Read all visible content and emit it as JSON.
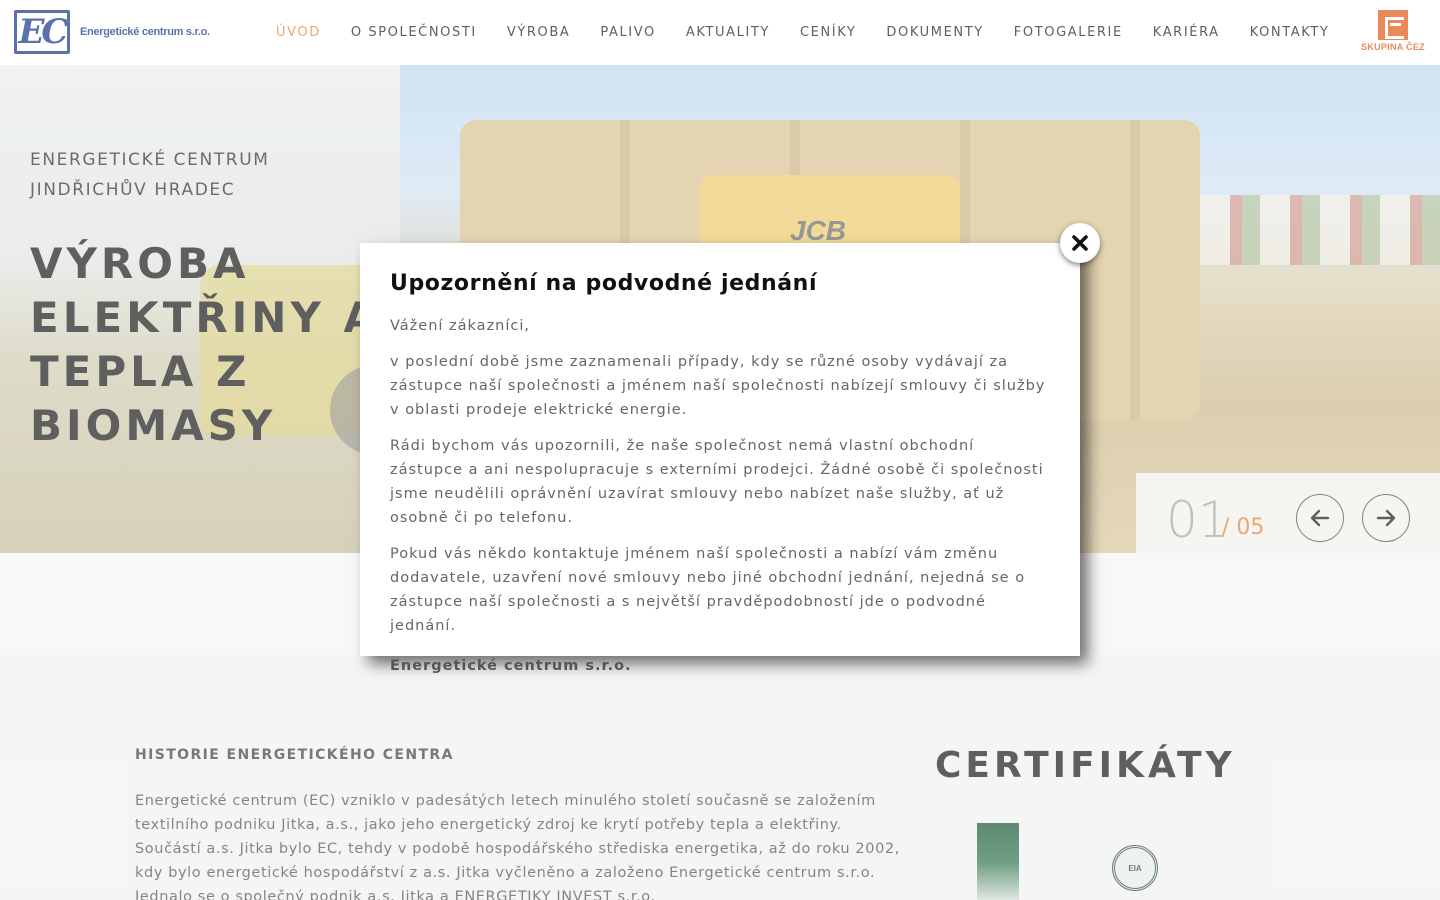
{
  "header": {
    "logo_mark": "EC",
    "logo_text": "Energetické centrum s.r.o.",
    "nav": [
      {
        "label": "ÚVOD",
        "active": true
      },
      {
        "label": "O SPOLEČNOSTI"
      },
      {
        "label": "VÝROBA"
      },
      {
        "label": "PALIVO"
      },
      {
        "label": "AKTUALITY"
      },
      {
        "label": "CENÍKY"
      },
      {
        "label": "DOKUMENTY"
      },
      {
        "label": "FOTOGALERIE"
      },
      {
        "label": "KARIÉRA"
      },
      {
        "label": "KONTAKTY"
      }
    ],
    "partner_label": "SKUPINA ČEZ",
    "accent_color": "#e8843a",
    "brand_color": "#1d3b8c",
    "partner_color": "#e35a1b"
  },
  "hero": {
    "subtitle_line1": "ENERGETICKÉ CENTRUM",
    "subtitle_line2": "JINDŘICHŮV HRADEC",
    "title": "VÝROBA ELEKTŘINY A TEPLA Z BIOMASY",
    "photo_label": "JCB",
    "slider": {
      "current": "01",
      "total": "/ 05",
      "prev_icon": "arrow-left-icon",
      "next_icon": "arrow-right-icon"
    }
  },
  "content": {
    "history_label": "HISTORIE ENERGETICKÉHO CENTRA",
    "history_text": "Energetické centrum (EC) vzniklo v padesátých letech minulého století současně se založením textilního podniku Jitka, a.s., jako jeho energetický zdroj ke krytí potřeby tepla a elektřiny. Součástí a.s. Jitka bylo EC, tehdy v podobě hospodářského střediska energetika, až do roku 2002, kdy bylo energetické hospodářství z a.s. Jitka vyčleněno a založeno Energetické centrum s.r.o. Jednalo se o společný podnik a.s. Jitka a ENERGETIKY INVEST s.r.o.",
    "cert_title": "CERTIFIKÁTY",
    "cert_badge": "EIA"
  },
  "modal": {
    "title": "Upozornění na podvodné jednání",
    "greeting": "Vážení zákazníci,",
    "p1": "v poslední době jsme zaznamenali případy, kdy se různé osoby vydávají za zástupce naší společnosti a jménem naší společnosti nabízejí smlouvy či služby v oblasti prodeje elektrické energie.",
    "p2": "Rádi bychom vás upozornili, že naše společnost nemá vlastní obchodní zástupce a ani nespolupracuje s externími prodejci. Žádné osobě či společnosti jsme neudělili oprávnění uzavírat smlouvy nebo nabízet naše služby, ať už osobně či po telefonu.",
    "p3": "Pokud vás někdo kontaktuje jménem naší společnosti a nabízí vám změnu dodavatele, uzavření nové smlouvy nebo jiné obchodní jednání, nejedná se o zástupce naší společnosti a s největší pravděpodobností jde o podvodné jednání.",
    "signature": "Energetické centrum s.r.o.",
    "close_icon": "close-icon"
  }
}
